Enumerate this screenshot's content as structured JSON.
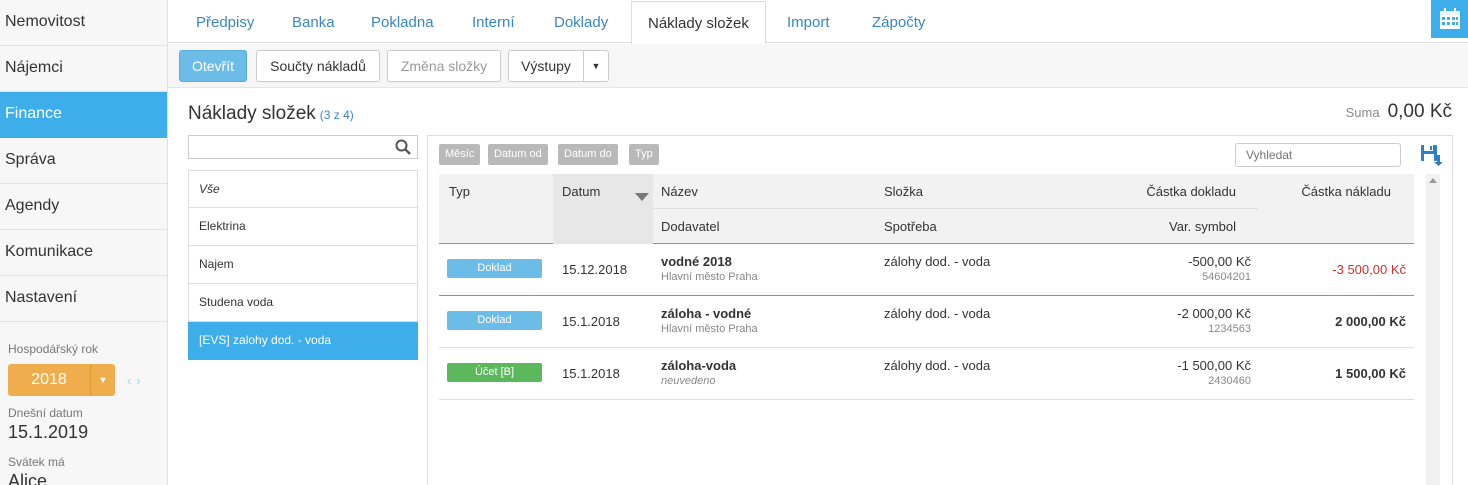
{
  "sidebar": {
    "items": [
      {
        "label": "Nemovitost"
      },
      {
        "label": "Nájemci"
      },
      {
        "label": "Finance"
      },
      {
        "label": "Správa"
      },
      {
        "label": "Agendy"
      },
      {
        "label": "Komunikace"
      },
      {
        "label": "Nastavení"
      }
    ],
    "fiscal_year_label": "Hospodářský rok",
    "fiscal_year": "2018",
    "today_label": "Dnešní datum",
    "today": "15.1.2019",
    "holiday_label": "Svátek má",
    "holiday_name": "Alice"
  },
  "tabs": [
    {
      "label": "Předpisy"
    },
    {
      "label": "Banka"
    },
    {
      "label": "Pokladna"
    },
    {
      "label": "Interní"
    },
    {
      "label": "Doklady"
    },
    {
      "label": "Náklady složek"
    },
    {
      "label": "Import"
    },
    {
      "label": "Zápočty"
    }
  ],
  "toolbar": {
    "open": "Otevřít",
    "sums": "Součty nákladů",
    "change": "Změna složky",
    "outputs": "Výstupy"
  },
  "page": {
    "title": "Náklady složek",
    "count": "(3 z 4)",
    "sum_label": "Suma",
    "sum_value": "0,00 Kč"
  },
  "filter": {
    "items": [
      {
        "label": "Vše"
      },
      {
        "label": "Elektrina"
      },
      {
        "label": "Najem"
      },
      {
        "label": "Studena voda"
      },
      {
        "label": "[EVS] zalohy dod. - voda"
      }
    ]
  },
  "chips": [
    "Měsíc",
    "Datum od",
    "Datum do",
    "Typ"
  ],
  "search": {
    "placeholder": "Vyhledat"
  },
  "table": {
    "headers": {
      "type": "Typ",
      "date": "Datum",
      "name": "Název",
      "supplier": "Dodavatel",
      "component": "Složka",
      "consumption": "Spotřeba",
      "doc_amount": "Částka dokladu",
      "var_symbol": "Var. symbol",
      "cost_amount": "Částka nákladu"
    },
    "rows": [
      {
        "type": "Doklad",
        "date": "15.12.2018",
        "name": "vodné 2018",
        "supplier": "Hlavní město Praha",
        "component": "zálohy dod. - voda",
        "doc_amount": "-500,00 Kč",
        "var_symbol": "54604201",
        "cost_amount": "-3 500,00 Kč"
      },
      {
        "type": "Doklad",
        "date": "15.1.2018",
        "name": "záloha - vodné",
        "supplier": "Hlavní město Praha",
        "component": "zálohy dod. - voda",
        "doc_amount": "-2 000,00 Kč",
        "var_symbol": "1234563",
        "cost_amount": "2 000,00 Kč"
      },
      {
        "type": "Účet [B]",
        "date": "15.1.2018",
        "name": "záloha-voda",
        "supplier": "neuvedeno",
        "component": "zálohy dod. - voda",
        "doc_amount": "-1 500,00 Kč",
        "var_symbol": "2430460",
        "cost_amount": "1 500,00 Kč"
      }
    ]
  },
  "colors": {
    "accent": "#3daee9",
    "warning": "#f0ad4e",
    "success": "#5cb85c",
    "negative": "#c9302c"
  }
}
